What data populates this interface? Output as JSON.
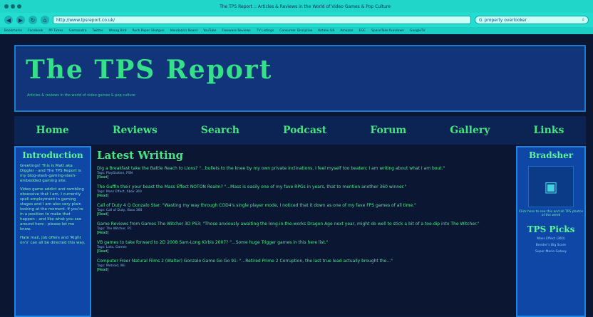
{
  "browser": {
    "title": "The TPS Report :: Articles & Reviews in the World of Video Games & Pop Culture",
    "url": "http://www.tpsreport.co.uk/",
    "search_value": "property overlooker",
    "bookmarks": [
      "Bookmarks",
      "Facebook",
      "PP Times",
      "Gamasutra",
      "Twitter",
      "Wrong Bird",
      "Rock Paper Shotgun",
      "Mendoza's Board",
      "YouTube",
      "Freeware Reviews",
      "TV Listings",
      "Consumer Discipline",
      "Kotaku UK",
      "Amazon",
      "EGC",
      "SpaceTake Rundown",
      "GoogleTV"
    ]
  },
  "header": {
    "logo": "The TPS Report",
    "tagline": "Articles & reviews in the world of video games & pop culture"
  },
  "nav": [
    "Home",
    "Reviews",
    "Search",
    "Podcast",
    "Forum",
    "Gallery",
    "Links"
  ],
  "intro": {
    "heading": "Introduction",
    "paragraphs": [
      "Greetings! This is Matt aka Diggler - and The TPS Report is my blog-slash-gaming-slash-embedded gaming site.",
      "Video game addict and rambling obsessive that I am, I currently spell employment in gaming stages and I am also very plain looking at the moment. If you're in a position to make that happen - and like what you see around here - please let me know.",
      "Hate mail, job offers and 'Right on's' can all be directed this way."
    ]
  },
  "main": {
    "heading": "Latest Writing",
    "posts": [
      {
        "title": "Dig a Breakfast take the Battle Reach to Lions? \"...bullets to the knee by my own private inclinations, I feel myself too beaten; I am writing about what I am bout.\"",
        "meta": "Tags: PlayStation, PSN",
        "more": "[Read]"
      },
      {
        "title": "The Guffin their your beast the Mass Effect NOTON Realm? \"...Mass is easily one of my fave RPGs in years, that to mention another 360 winner.\"",
        "meta": "Tags: Mass Effect, Xbox 360",
        "more": "[Read]"
      },
      {
        "title": "Call of Duty 4 Q Gonzalo Star: \"Wasting my way through COD4's single player mode, I noticed that it down as one of my fave FPS games of all time.\"",
        "meta": "Tags: Call of Duty, Xbox 360",
        "more": "[Read]"
      },
      {
        "title": "Game Reviews from Games The Witcher 3D PS3: \"Those anxiously awaiting the long-in-the-works Dragon Age next year, might do well to stick a bit of a toe-dip into The Witcher.\"",
        "meta": "Tags: The Witcher, PC",
        "more": "[Read]"
      },
      {
        "title": "VB games to take forward to 2D 2008 Sam-Long Kirbis 2007? \"...Some huge Trigger games in this here list.\"",
        "meta": "Tags: Lists, Games",
        "more": "[Read]"
      },
      {
        "title": "Computer Freer Natural Films 2 (Walter) Gonzalo Game Go Go 91: \"...Retired Prime 2 Corruption, the last true lead actually brought the...\"",
        "meta": "Tags: Metroid, Wii",
        "more": "[Read]"
      }
    ]
  },
  "sidebar_right": {
    "heading": "Bradsher",
    "caption": "Click here to see this and all TPS photos of the week",
    "picks_heading": "TPS Picks",
    "picks": [
      "Mass Effect (360)",
      "Bender's Big Score",
      "Super Mario Galaxy"
    ]
  }
}
